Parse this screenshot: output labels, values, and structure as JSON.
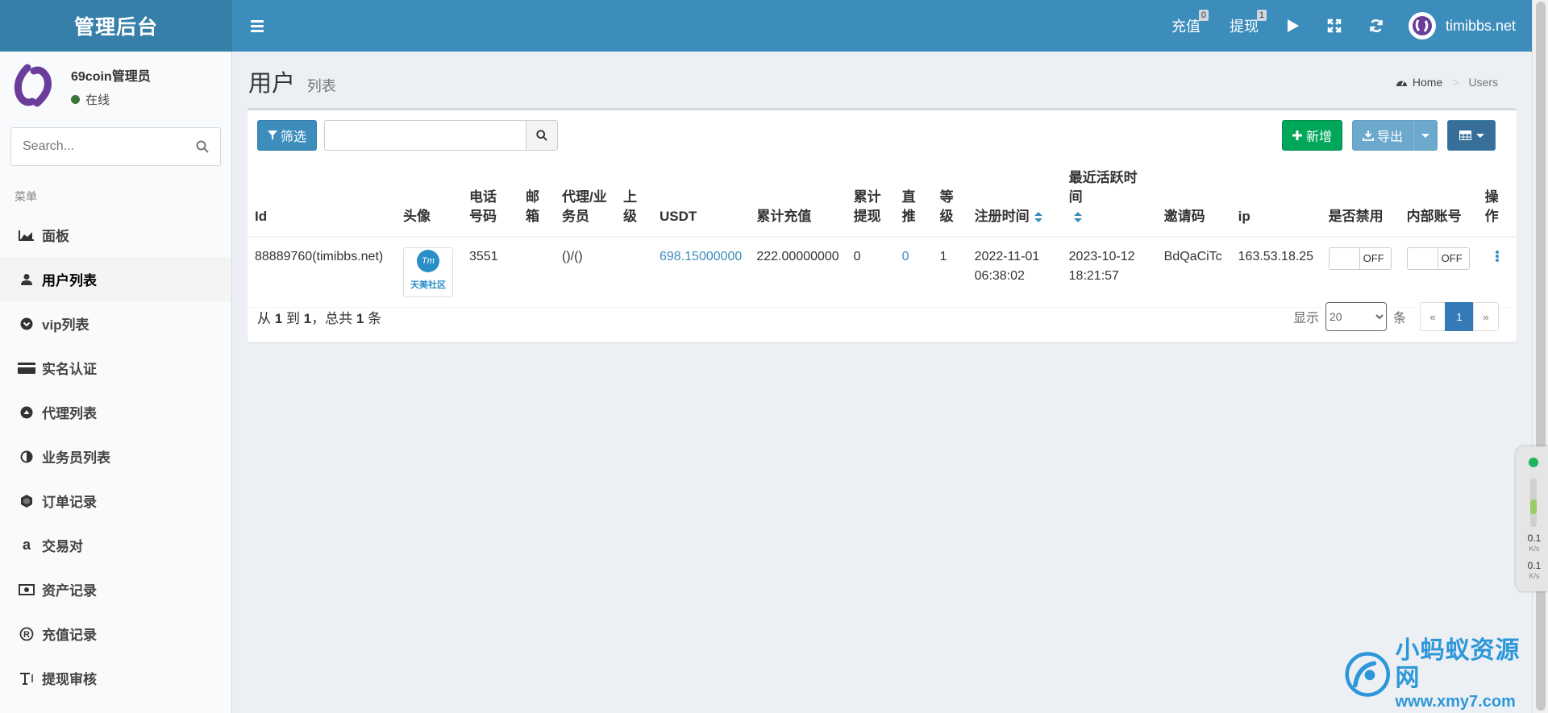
{
  "header": {
    "logo": "管理后台",
    "recharge": {
      "label": "充值",
      "count": "0"
    },
    "withdraw": {
      "label": "提现",
      "count": "1"
    },
    "username": "timibbs.net"
  },
  "sidebar": {
    "user": {
      "name": "69coin管理员",
      "status": "在线"
    },
    "search_placeholder": "Search...",
    "menu_header": "菜单",
    "items": [
      {
        "label": "面板",
        "icon": "area-chart-icon"
      },
      {
        "label": "用户列表",
        "icon": "user-icon"
      },
      {
        "label": "vip列表",
        "icon": "chevron-circle-icon"
      },
      {
        "label": "实名认证",
        "icon": "credit-card-icon"
      },
      {
        "label": "代理列表",
        "icon": "eject-circle-icon"
      },
      {
        "label": "业务员列表",
        "icon": "adjust-icon"
      },
      {
        "label": "订单记录",
        "icon": "ship-icon"
      },
      {
        "label": "交易对",
        "icon": "amazon-icon"
      },
      {
        "label": "资产记录",
        "icon": "money-icon"
      },
      {
        "label": "充值记录",
        "icon": "registered-icon"
      },
      {
        "label": "提现审核",
        "icon": "text-height-icon"
      }
    ]
  },
  "page": {
    "title": "用户",
    "subtitle": "列表",
    "breadcrumb": [
      "Home",
      "Users"
    ]
  },
  "toolbar": {
    "filter_label": "筛选",
    "add_label": "新增",
    "export_label": "导出"
  },
  "table": {
    "headers": {
      "id": "Id",
      "avatar": "头像",
      "phone": "电话号码",
      "email": "邮箱",
      "agent": "代理/业务员",
      "parent": "上级",
      "usdt": "USDT",
      "total_recharge": "累计充值",
      "total_withdraw": "累计提现",
      "direct": "直推",
      "level": "等级",
      "reg_time": "注册时间",
      "last_active": "最近活跃时间",
      "invite_code": "邀请码",
      "ip": "ip",
      "banned": "是否禁用",
      "internal": "内部账号",
      "actions": "操作"
    },
    "rows": [
      {
        "id": "88889760(timibbs.net)",
        "avatar_caption": "天美社区",
        "avatar_mark": "Tm",
        "phone": "3551",
        "email": "",
        "agent": "()/()",
        "parent": "",
        "usdt": "698.15000000",
        "total_recharge": "222.00000000",
        "total_withdraw": "0",
        "direct": "0",
        "level": "1",
        "reg_time_date": "2022-11-01",
        "reg_time_time": "06:38:02",
        "last_active_date": "2023-10-12",
        "last_active_time": "18:21:57",
        "invite_code": "BdQaCiTc",
        "ip": "163.53.18.25",
        "banned": "OFF",
        "internal": "OFF"
      }
    ]
  },
  "footer": {
    "summary_prefix": "从",
    "from": "1",
    "to_word": "到",
    "to": "1",
    "total_word": "，总共",
    "total": "1",
    "unit": "条",
    "show_label": "显示",
    "page_size": "20",
    "per_unit": "条",
    "prev": "«",
    "current_page": "1",
    "next": "»"
  },
  "net_widget": {
    "up_value": "0.1",
    "down_value": "0.1",
    "unit": "K/s"
  },
  "watermark": {
    "line1": "小蚂蚁资源网",
    "line2": "www.xmy7.com"
  }
}
